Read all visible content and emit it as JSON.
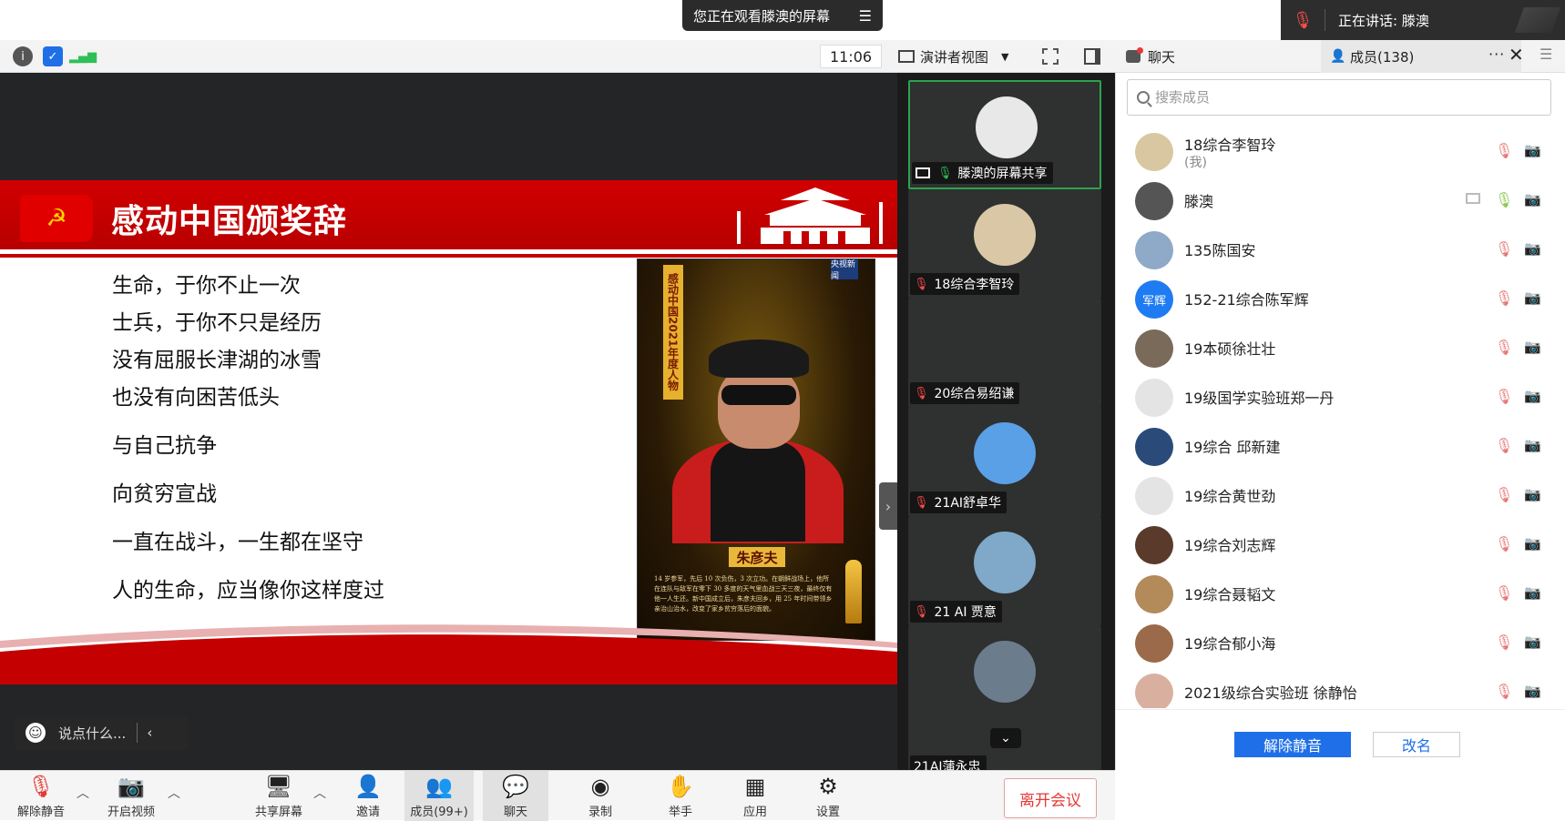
{
  "banner": {
    "viewing_text": "您正在观看滕澳的屏幕",
    "speaking_text": "正在讲话: 滕澳"
  },
  "toolbar": {
    "time": "11:06",
    "presenter_view": "演讲者视图"
  },
  "panel": {
    "chat_tab": "聊天",
    "members_tab": "成员(138)",
    "more": "···",
    "close": "✕",
    "menu": "☰"
  },
  "slide": {
    "title": "感动中国颁奖辞",
    "poem": [
      "生命，于你不止一次",
      "士兵，于你不只是经历",
      "没有屈服长津湖的冰雪",
      "也没有向困苦低头",
      "与自己抗争",
      "向贫穷宣战",
      "一直在战斗，一生都在坚守",
      "人的生命，应当像你这样度过"
    ],
    "poster_vertical": "感动中国2021年度人物",
    "poster_badge": "央视新闻",
    "poster_name": "朱彦夫",
    "poster_desc": "14 岁参军，先后 10 次负伤，3 次立功。在朝鲜战场上，他所在连队与敌军在零下 30 多度的天气里血战三天三夜，最终仅有他一人生还。新中国成立后，朱彦夫回乡，用 25 年时间带领乡亲治山治水，改变了家乡贫穷落后的面貌。"
  },
  "comment": {
    "placeholder": "说点什么..."
  },
  "videos": [
    {
      "label": "滕澳的屏幕共享",
      "avatar_color": "#e8e8e8"
    },
    {
      "label": "18综合李智玲",
      "avatar_color": "#d9c7a6"
    },
    {
      "label": "20综合易绍谦",
      "avatar_color": ""
    },
    {
      "label": "21AI舒卓华",
      "avatar_color": "#5aa0e6"
    },
    {
      "label": "21 AI 贾意",
      "avatar_color": "#7fa8c9"
    },
    {
      "label": "21AI蒲永忠",
      "avatar_color": "#6b7d8c"
    }
  ],
  "members": {
    "search_placeholder": "搜索成员",
    "list": [
      {
        "name": "18综合李智玲",
        "sub": "(我)",
        "avatar_color": "#d8c7a0",
        "avatar_text": ""
      },
      {
        "name": "滕澳",
        "sub": "",
        "avatar_color": "#555555",
        "avatar_text": ""
      },
      {
        "name": "135陈国安",
        "sub": "",
        "avatar_color": "#8fa9c8",
        "avatar_text": ""
      },
      {
        "name": "152-21综合陈军辉",
        "sub": "",
        "avatar_color": "#1f7bf2",
        "avatar_text": "军辉"
      },
      {
        "name": "19本硕徐壮壮",
        "sub": "",
        "avatar_color": "#7a6a5a",
        "avatar_text": ""
      },
      {
        "name": "19级国学实验班郑一丹",
        "sub": "",
        "avatar_color": "#e4e4e4",
        "avatar_text": ""
      },
      {
        "name": "19综合 邱新建",
        "sub": "",
        "avatar_color": "#2a4a7a",
        "avatar_text": ""
      },
      {
        "name": "19综合黄世劲",
        "sub": "",
        "avatar_color": "#e4e4e4",
        "avatar_text": ""
      },
      {
        "name": "19综合刘志辉",
        "sub": "",
        "avatar_color": "#5a3a2a",
        "avatar_text": ""
      },
      {
        "name": "19综合聂韬文",
        "sub": "",
        "avatar_color": "#b38a5a",
        "avatar_text": ""
      },
      {
        "name": "19综合郁小海",
        "sub": "",
        "avatar_color": "#9a6a4a",
        "avatar_text": ""
      },
      {
        "name": "2021级综合实验班 徐静怡",
        "sub": "",
        "avatar_color": "#d9b0a0",
        "avatar_text": ""
      }
    ],
    "unmute_all": "解除静音",
    "rename": "改名"
  },
  "bottom": {
    "unmute": "解除静音",
    "start_video": "开启视频",
    "share_screen": "共享屏幕",
    "invite": "邀请",
    "members": "成员(99+)",
    "chat": "聊天",
    "record": "录制",
    "raise_hand": "举手",
    "apps": "应用",
    "settings": "设置",
    "leave": "离开会议"
  },
  "colors": {
    "accent": "#1f6fe8",
    "slide_red": "#c40000",
    "active_green": "#2aa44f",
    "leave_red": "#e53935"
  }
}
